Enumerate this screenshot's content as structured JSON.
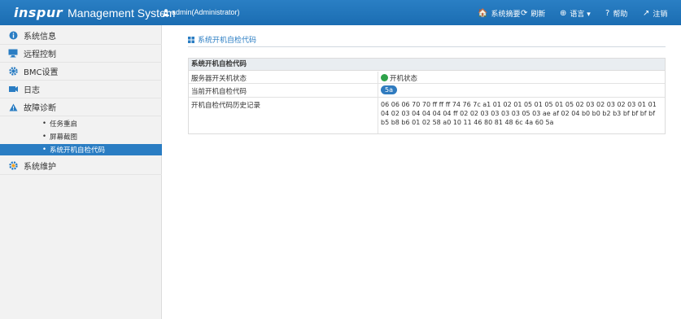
{
  "header": {
    "logo": "inspur",
    "title": "Management System",
    "user": "admin(Administrator)",
    "nav": [
      {
        "icon": "home-icon",
        "glyph": "🏠",
        "label": "系统摘要"
      },
      {
        "icon": "refresh-icon",
        "glyph": "⟳",
        "label": "刷新"
      },
      {
        "icon": "globe-icon",
        "glyph": "⊕",
        "label": "语言 ▾"
      },
      {
        "icon": "help-icon",
        "glyph": "?",
        "label": "帮助"
      },
      {
        "icon": "logout-icon",
        "glyph": "↗",
        "label": "注销"
      }
    ]
  },
  "sidebar": {
    "items": [
      {
        "label": "系统信息",
        "icon": "info-icon"
      },
      {
        "label": "远程控制",
        "icon": "monitor-icon"
      },
      {
        "label": "BMC设置",
        "icon": "gear-icon"
      },
      {
        "label": "日志",
        "icon": "log-icon"
      },
      {
        "label": "故障诊断",
        "icon": "warning-icon"
      }
    ],
    "sub_items": [
      {
        "label": "任务重启"
      },
      {
        "label": "屏幕截图"
      },
      {
        "label": "系统开机自检代码"
      }
    ],
    "last_item": {
      "label": "系统维护",
      "icon": "maintenance-icon"
    },
    "active_color": "#2a7dc3"
  },
  "breadcrumb": "系统开机自检代码",
  "panel": {
    "title": "系统开机自检代码",
    "rows": [
      {
        "key": "服务器开关机状态",
        "value": "开机状态"
      },
      {
        "key": "当前开机自检代码",
        "value": "5a"
      },
      {
        "key": "开机自检代码历史记录",
        "value": "06 06 06 70 70 ff ff ff 74 76 7c a1 01 02 01 05 01 05 01 05 02 03 02 03 02 03 01 01 04 02 03 04 04 04 04 ff 02 02 03 03 03 03 05 03 ae af 02 04 b0 b0 b2 b3 bf bf bf bf b5 b8 b6 01 02 58 a0 10 11 46 80 81 48 6c 4a 60 5a"
      }
    ]
  }
}
